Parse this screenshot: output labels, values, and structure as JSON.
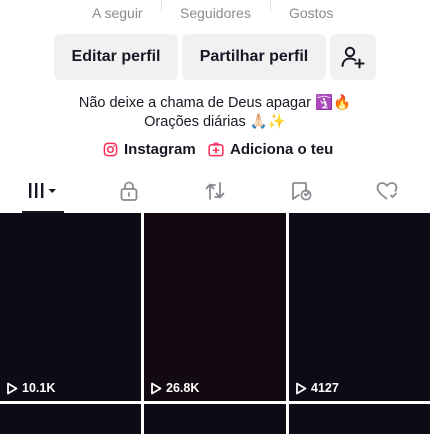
{
  "stats": {
    "following_label": "A seguir",
    "followers_label": "Seguidores",
    "likes_label": "Gostos"
  },
  "actions": {
    "edit_profile": "Editar perfil",
    "share_profile": "Partilhar perfil",
    "add_friends_icon": "add-user-icon"
  },
  "bio": {
    "line1": "Não deixe a chama de Deus apagar 🛐🔥",
    "line2": "Orações diárias 🙏🏻✨"
  },
  "links": {
    "instagram_label": "Instagram",
    "add_yours_label": "Adiciona o teu",
    "accent_color": "#fe2c55"
  },
  "tabs": [
    {
      "name": "videos",
      "icon": "grid-icon",
      "selected": true
    },
    {
      "name": "private",
      "icon": "lock-icon",
      "selected": false
    },
    {
      "name": "reposts",
      "icon": "repost-icon",
      "selected": false
    },
    {
      "name": "favorites",
      "icon": "bookmark-icon",
      "selected": false
    },
    {
      "name": "liked",
      "icon": "heart-icon",
      "selected": false
    }
  ],
  "videos": [
    {
      "views": "10.1K",
      "color": "#0b0c16"
    },
    {
      "views": "26.8K",
      "color": "#130910"
    },
    {
      "views": "4127",
      "color": "#0c0c16"
    },
    {
      "views": "",
      "color": "#0b0c16"
    },
    {
      "views": "",
      "color": "#0b0c16"
    },
    {
      "views": "",
      "color": "#0b0c16"
    }
  ]
}
